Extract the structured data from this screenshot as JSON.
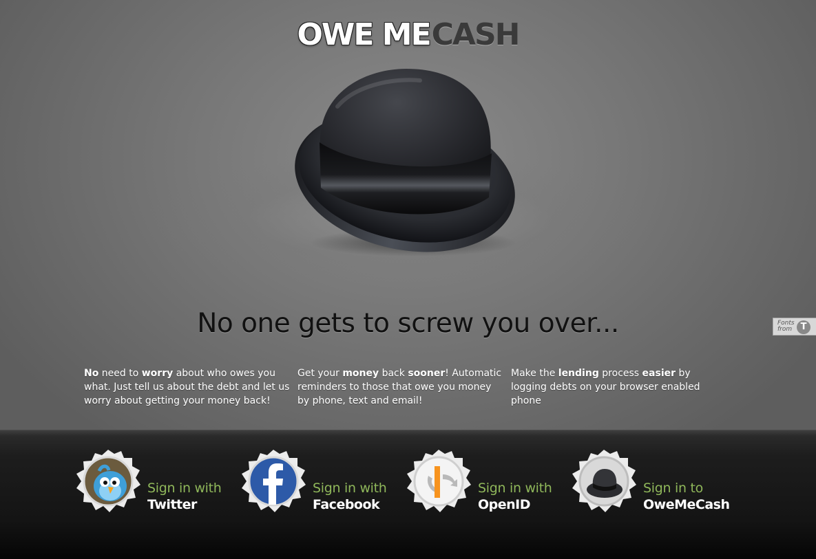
{
  "logo": {
    "part1": "OWE ME",
    "part2": "CASH"
  },
  "headline": "No one gets to screw you over...",
  "fonts_badge": {
    "line1": "Fonts",
    "line2": "from"
  },
  "features": [
    {
      "parts": [
        {
          "b": "No"
        },
        {
          "t": " need to "
        },
        {
          "b": "worry"
        },
        {
          "t": " about who owes you what. Just tell us about the debt and let us worry about getting your money back!"
        }
      ]
    },
    {
      "parts": [
        {
          "t": "Get your "
        },
        {
          "b": "money"
        },
        {
          "t": " back "
        },
        {
          "b": "sooner"
        },
        {
          "t": "! Automatic reminders to those that owe you money by phone, text and email!"
        }
      ]
    },
    {
      "parts": [
        {
          "t": "Make the "
        },
        {
          "b": "lending"
        },
        {
          "t": " process "
        },
        {
          "b": "easier"
        },
        {
          "t": " by logging debts on your browser enabled phone"
        }
      ]
    }
  ],
  "signin": {
    "twitter": {
      "line1": "Sign in with",
      "line2": "Twitter",
      "icon": "twitter-bird-icon"
    },
    "facebook": {
      "line1": "Sign in with",
      "line2": "Facebook",
      "icon": "facebook-icon"
    },
    "openid": {
      "line1": "Sign in with",
      "line2": "OpenID",
      "icon": "openid-icon"
    },
    "owemecash": {
      "line1": "Sign in to",
      "line2": "OweMeCash",
      "icon": "bowler-hat-icon"
    }
  },
  "colors": {
    "accent_green": "#8fb75a",
    "footer_bg": "#141414",
    "stage_bg": "#777777"
  }
}
